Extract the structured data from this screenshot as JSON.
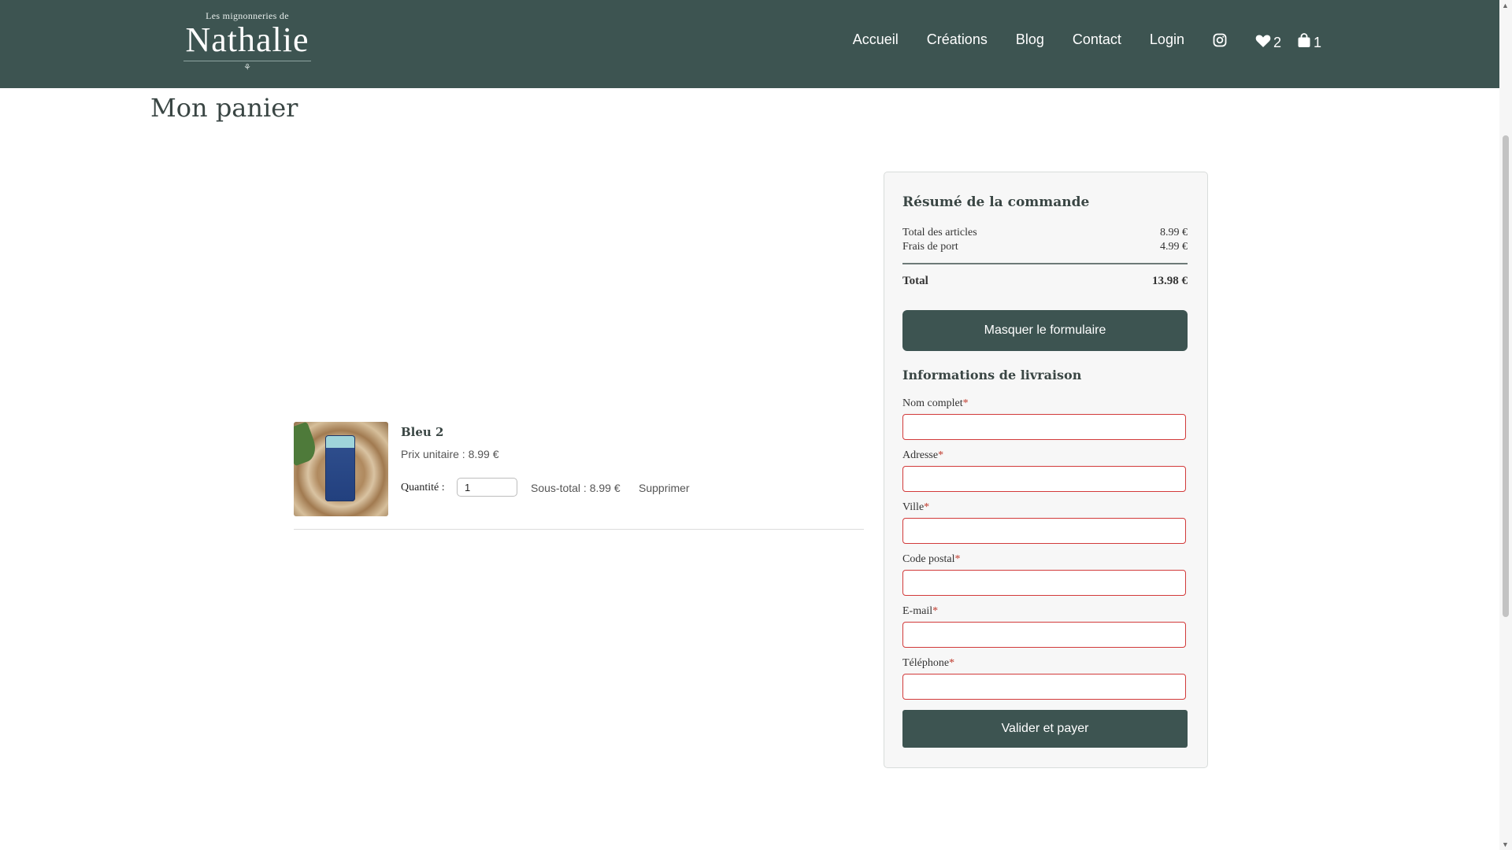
{
  "header": {
    "logo_small": "Les mignonneries de",
    "logo_big": "Nathalie",
    "logo_ornament": "⚘",
    "nav": [
      {
        "label": "Accueil"
      },
      {
        "label": "Créations"
      },
      {
        "label": "Blog"
      },
      {
        "label": "Contact"
      },
      {
        "label": "Login"
      }
    ],
    "instagram_icon": "instagram-icon",
    "wishlist_icon": "heart-icon",
    "wishlist_count": "2",
    "cart_icon": "shopping-bag-icon",
    "cart_count": "1",
    "colors": {
      "header_bg": "#3d5451",
      "accent": "#3d5451",
      "error_border": "#d23a3a"
    }
  },
  "page": {
    "title": "Mon panier"
  },
  "cart": {
    "items": [
      {
        "name": "Bleu 2",
        "unit_price": "Prix unitaire : 8.99 €",
        "quantity_label": "Quantité :",
        "quantity_value": "1",
        "subtotal": "Sous-total : 8.99 €",
        "remove_label": "Supprimer"
      }
    ]
  },
  "summary": {
    "title": "Résumé de la commande",
    "items_total_label": "Total des articles",
    "items_total_value": "8.99 €",
    "shipping_label": "Frais de port",
    "shipping_value": "4.99 €",
    "total_label": "Total",
    "total_value": "13.98 €",
    "toggle_button": "Masquer le formulaire",
    "shipping_info_title": "Informations de livraison",
    "fields": [
      {
        "label": "Nom complet",
        "value": ""
      },
      {
        "label": "Adresse",
        "value": ""
      },
      {
        "label": "Ville",
        "value": ""
      },
      {
        "label": "Code postal",
        "value": ""
      },
      {
        "label": "E-mail",
        "value": ""
      },
      {
        "label": "Téléphone",
        "value": ""
      }
    ],
    "required_mark": "*",
    "pay_button": "Valider et payer"
  }
}
